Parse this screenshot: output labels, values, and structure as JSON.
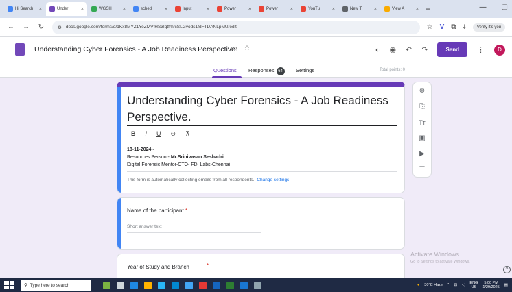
{
  "browser": {
    "tabs": [
      {
        "label": "Hi Search",
        "color": "#4285f4",
        "active": false
      },
      {
        "label": "Under",
        "color": "#7248b9",
        "active": true
      },
      {
        "label": "WGSH",
        "color": "#34a853",
        "active": false
      },
      {
        "label": "sched",
        "color": "#4285f4",
        "active": false
      },
      {
        "label": "Input",
        "color": "#ea4335",
        "active": false
      },
      {
        "label": "Power",
        "color": "#ea4335",
        "active": false
      },
      {
        "label": "Power",
        "color": "#ea4335",
        "active": false
      },
      {
        "label": "YouTu",
        "color": "#ea4335",
        "active": false
      },
      {
        "label": "New T",
        "color": "#5f6368",
        "active": false
      },
      {
        "label": "View A",
        "color": "#f9ab00",
        "active": false
      }
    ],
    "url": "docs.google.com/forms/d/1Kx8MYZ1YeZMVfHS3Iqtfrh/cSLGvods1fdFTDANLpMU/edit",
    "verify_label": "Verify it's you"
  },
  "forms_header": {
    "doc_title": "Understanding Cyber Forensics - A Job Readiness Perspective.",
    "send_label": "Send",
    "avatar_letter": "D",
    "tabs": {
      "questions": "Questions",
      "responses": "Responses",
      "responses_count": "64",
      "settings": "Settings"
    },
    "total_points": "Total points: 0"
  },
  "title_card": {
    "title": "Understanding Cyber Forensics -  A Job Readiness Perspective.",
    "format_buttons": [
      "B",
      "I",
      "U",
      "⊖",
      "⊼"
    ],
    "date": "18-11-2024 -",
    "resource_prefix": "Resources Person  - ",
    "resource_name": "Mr.Srinivasan Seshadri",
    "role": "Digital Forensic Mentor-CTO- FDI Labs-Chennai",
    "email_note": "This form is automatically collecting emails from all respondents.",
    "email_link": "Change settings"
  },
  "question1": {
    "title": "Name of the participant",
    "required_mark": "*",
    "placeholder": "Short answer text"
  },
  "question2": {
    "title": "Year of Study and Branch",
    "required_mark": "*"
  },
  "watermark": {
    "title": "Activate Windows",
    "subtitle": "Go to Settings to activate Windows."
  },
  "taskbar": {
    "search_placeholder": "Type here to search",
    "weather": "30°C Haze",
    "lang_top": "ENG",
    "lang_bottom": "US",
    "time": "5:00 PM",
    "date": "1/29/2025"
  }
}
